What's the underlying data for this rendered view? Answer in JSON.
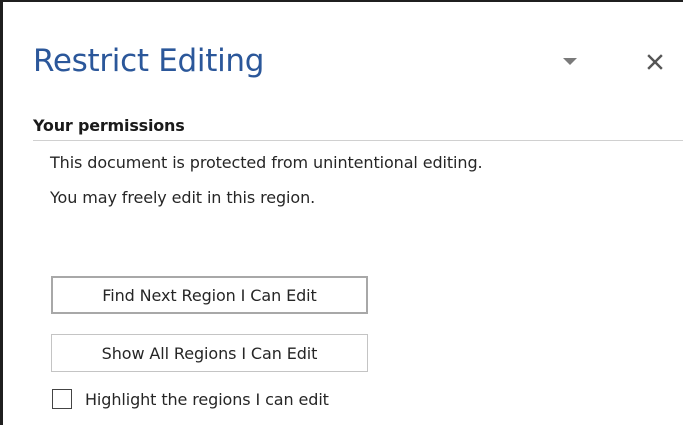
{
  "pane": {
    "title": "Restrict Editing",
    "dropdown_icon": "triangle-down-icon",
    "close_icon": "close-x-icon",
    "accent_color": "#2b579a"
  },
  "permissions": {
    "heading": "Your permissions",
    "status_line": "This document is protected from unintentional editing.",
    "region_line": "You may freely edit in this region."
  },
  "actions": {
    "find_next_label": "Find Next Region I Can Edit",
    "show_all_label": "Show All Regions I Can Edit",
    "highlight_label": "Highlight the regions I can edit",
    "highlight_checked": false
  }
}
